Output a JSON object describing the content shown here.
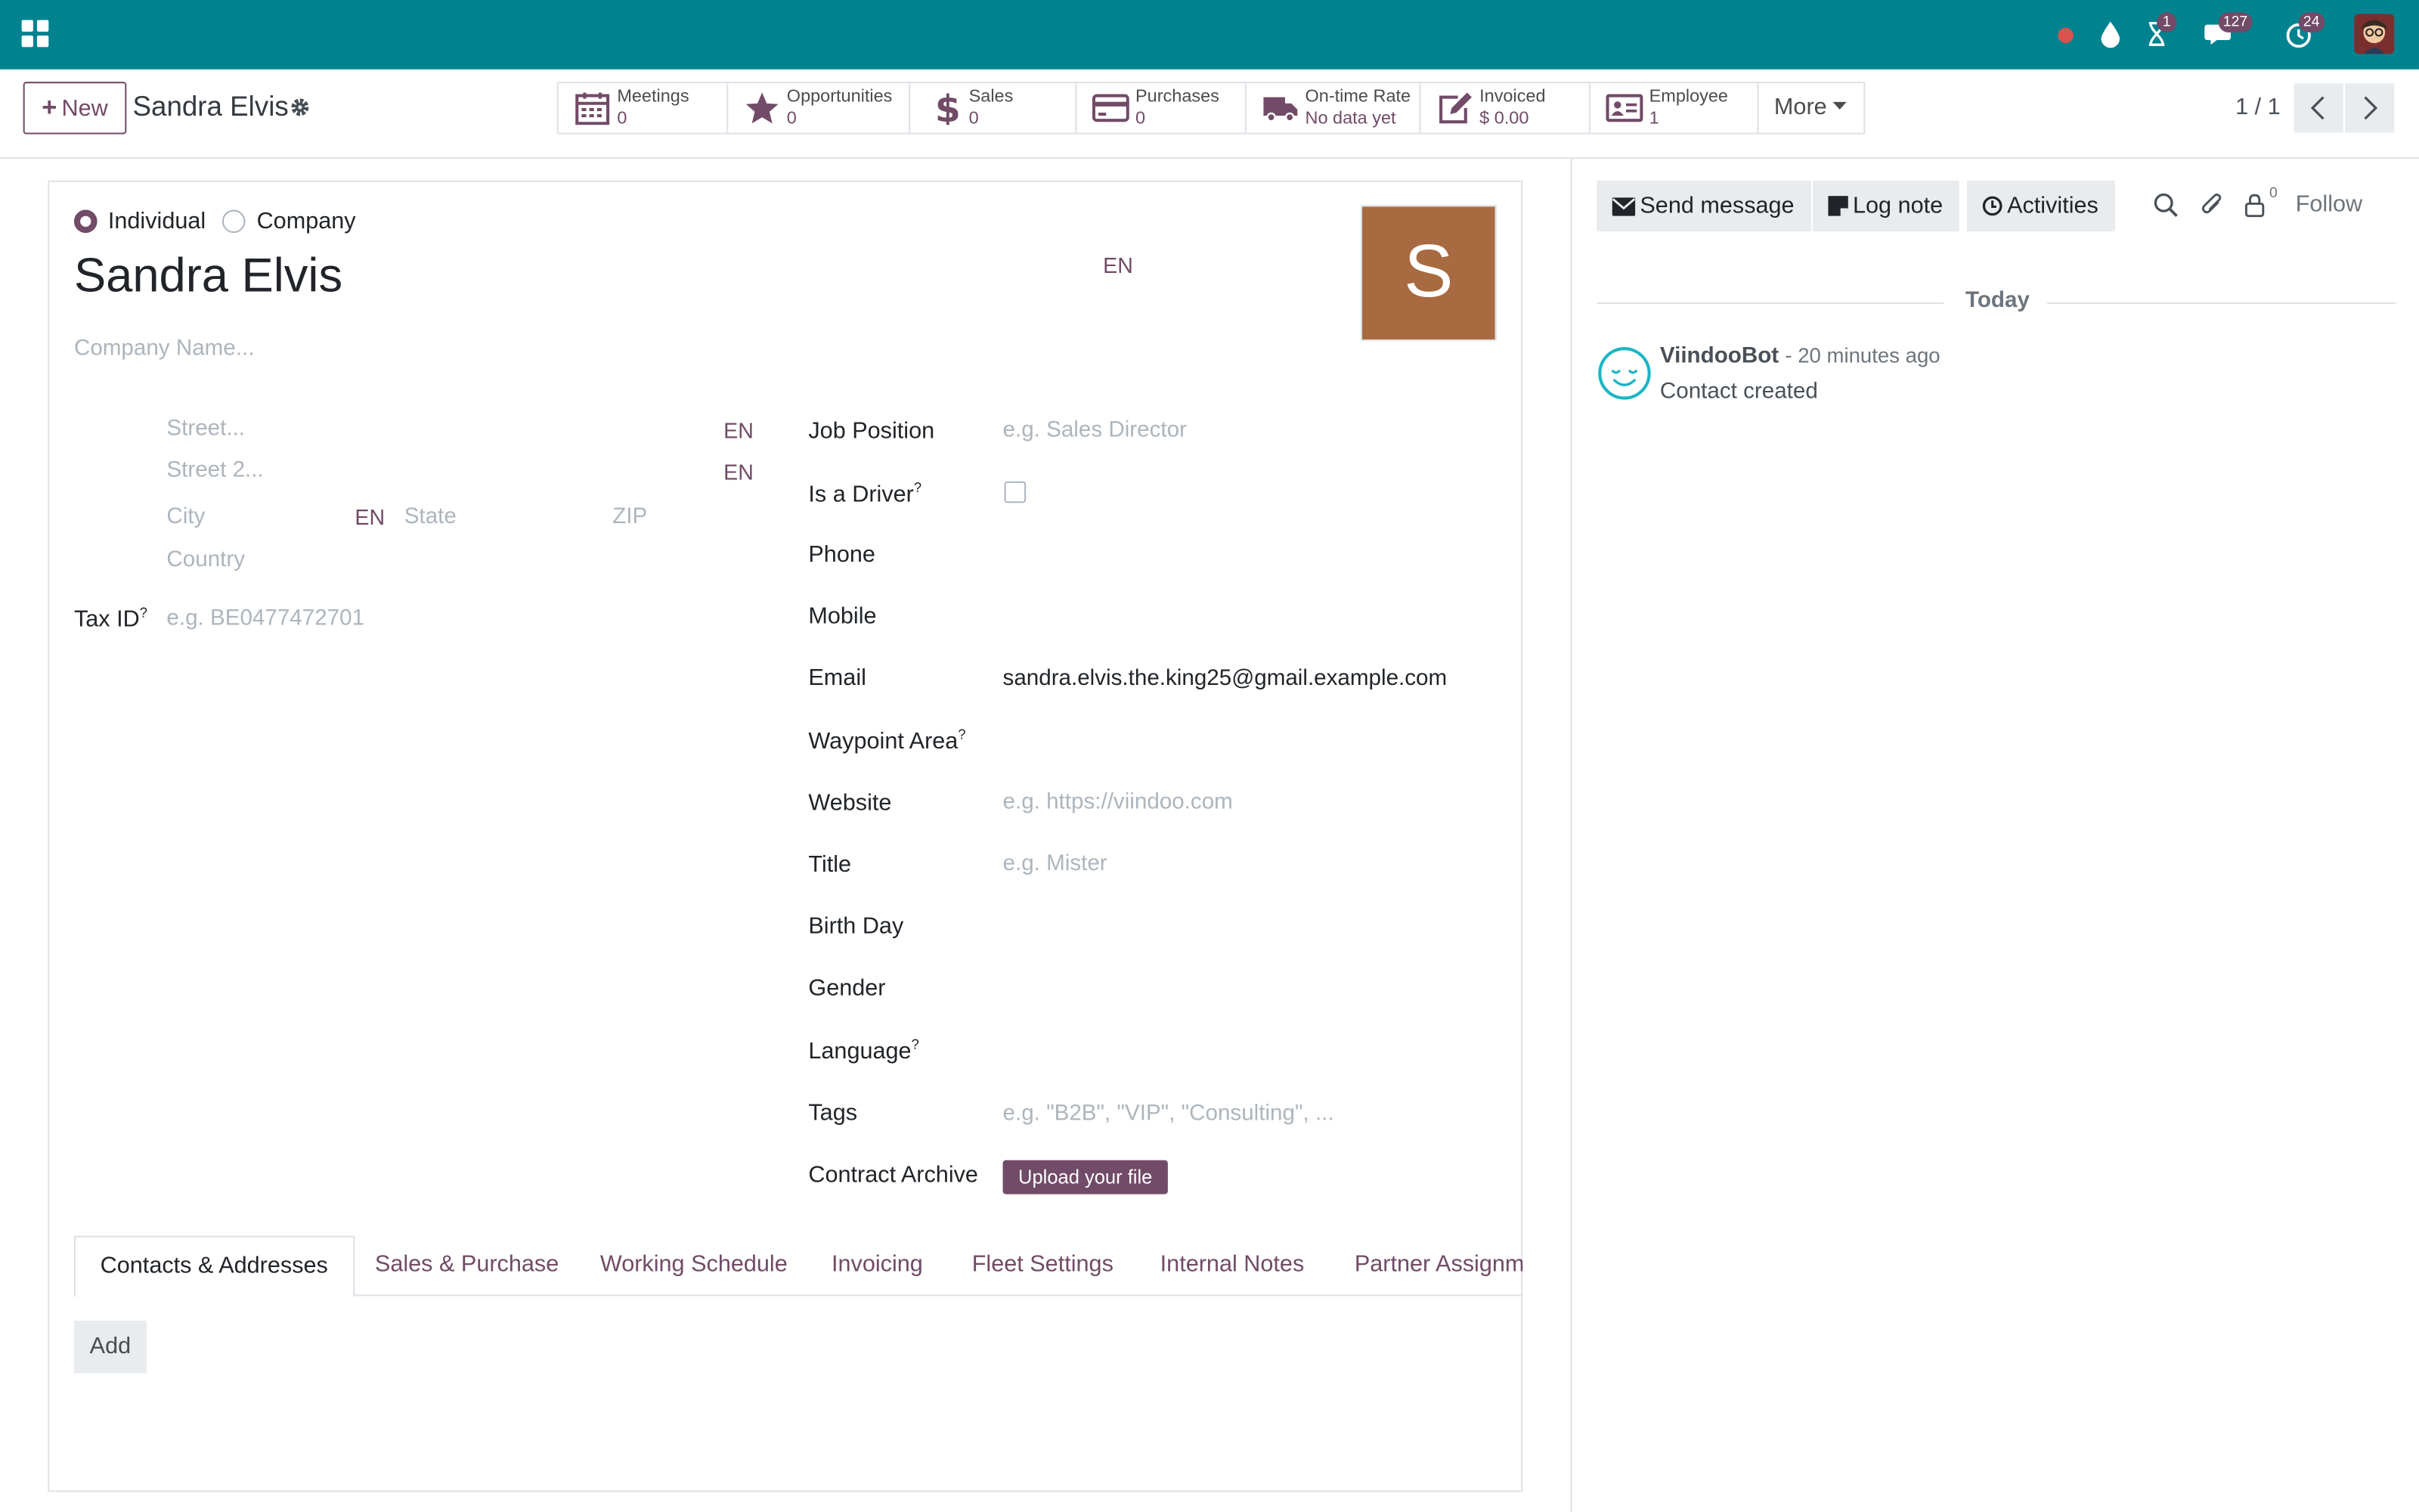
{
  "navbar": {
    "badges": {
      "activities": "1",
      "messages": "127",
      "timesheet": "24"
    },
    "colors": {
      "bar": "#00838f",
      "accent": "#714b67"
    }
  },
  "control_panel": {
    "new_label": "New",
    "record_name": "Sandra Elvis",
    "smart_buttons": [
      {
        "icon": "calendar-icon",
        "label": "Meetings",
        "value": "0"
      },
      {
        "icon": "star-icon",
        "label": "Opportunities",
        "value": "0"
      },
      {
        "icon": "dollar-icon",
        "label": "Sales",
        "value": "0"
      },
      {
        "icon": "credit-card-icon",
        "label": "Purchases",
        "value": "0"
      },
      {
        "icon": "truck-icon",
        "label": "On-time Rate",
        "value": "No data yet"
      },
      {
        "icon": "edit-icon",
        "label": "Invoiced",
        "value": "$ 0.00"
      },
      {
        "icon": "id-card-icon",
        "label": "Employee",
        "value": "1"
      }
    ],
    "more_label": "More",
    "pager": "1 / 1"
  },
  "form": {
    "type_individual": "Individual",
    "type_company": "Company",
    "name": "Sandra Elvis",
    "lang_tag": "EN",
    "avatar_letter": "S",
    "company_placeholder": "Company Name...",
    "street_placeholder": "Street...",
    "street2_placeholder": "Street 2...",
    "city_placeholder": "City",
    "state_placeholder": "State",
    "zip_placeholder": "ZIP",
    "country_placeholder": "Country",
    "tax_label": "Tax ID",
    "tax_placeholder": "e.g. BE0477472701",
    "help_mark": "?",
    "fields": {
      "job_position": {
        "label": "Job Position",
        "placeholder": "e.g. Sales Director"
      },
      "is_driver": {
        "label": "Is a Driver"
      },
      "phone": {
        "label": "Phone"
      },
      "mobile": {
        "label": "Mobile"
      },
      "email": {
        "label": "Email",
        "value": "sandra.elvis.the.king25@gmail.example.com"
      },
      "waypoint": {
        "label": "Waypoint Area"
      },
      "website": {
        "label": "Website",
        "placeholder": "e.g. https://viindoo.com"
      },
      "title": {
        "label": "Title",
        "placeholder": "e.g. Mister"
      },
      "birth_day": {
        "label": "Birth Day"
      },
      "gender": {
        "label": "Gender"
      },
      "language": {
        "label": "Language"
      },
      "tags": {
        "label": "Tags",
        "placeholder": "e.g. \"B2B\", \"VIP\", \"Consulting\", ..."
      },
      "contract_archive": {
        "label": "Contract Archive",
        "button": "Upload your file"
      }
    },
    "tabs": [
      "Contacts & Addresses",
      "Sales & Purchase",
      "Working Schedule",
      "Invoicing",
      "Fleet Settings",
      "Internal Notes",
      "Partner Assignm"
    ],
    "add_label": "Add"
  },
  "chatter": {
    "send_message": "Send message",
    "log_note": "Log note",
    "activities": "Activities",
    "followers_count": "0",
    "follow": "Follow",
    "today": "Today",
    "message": {
      "author": "ViindooBot",
      "time": "- 20 minutes ago",
      "body": "Contact created"
    }
  }
}
